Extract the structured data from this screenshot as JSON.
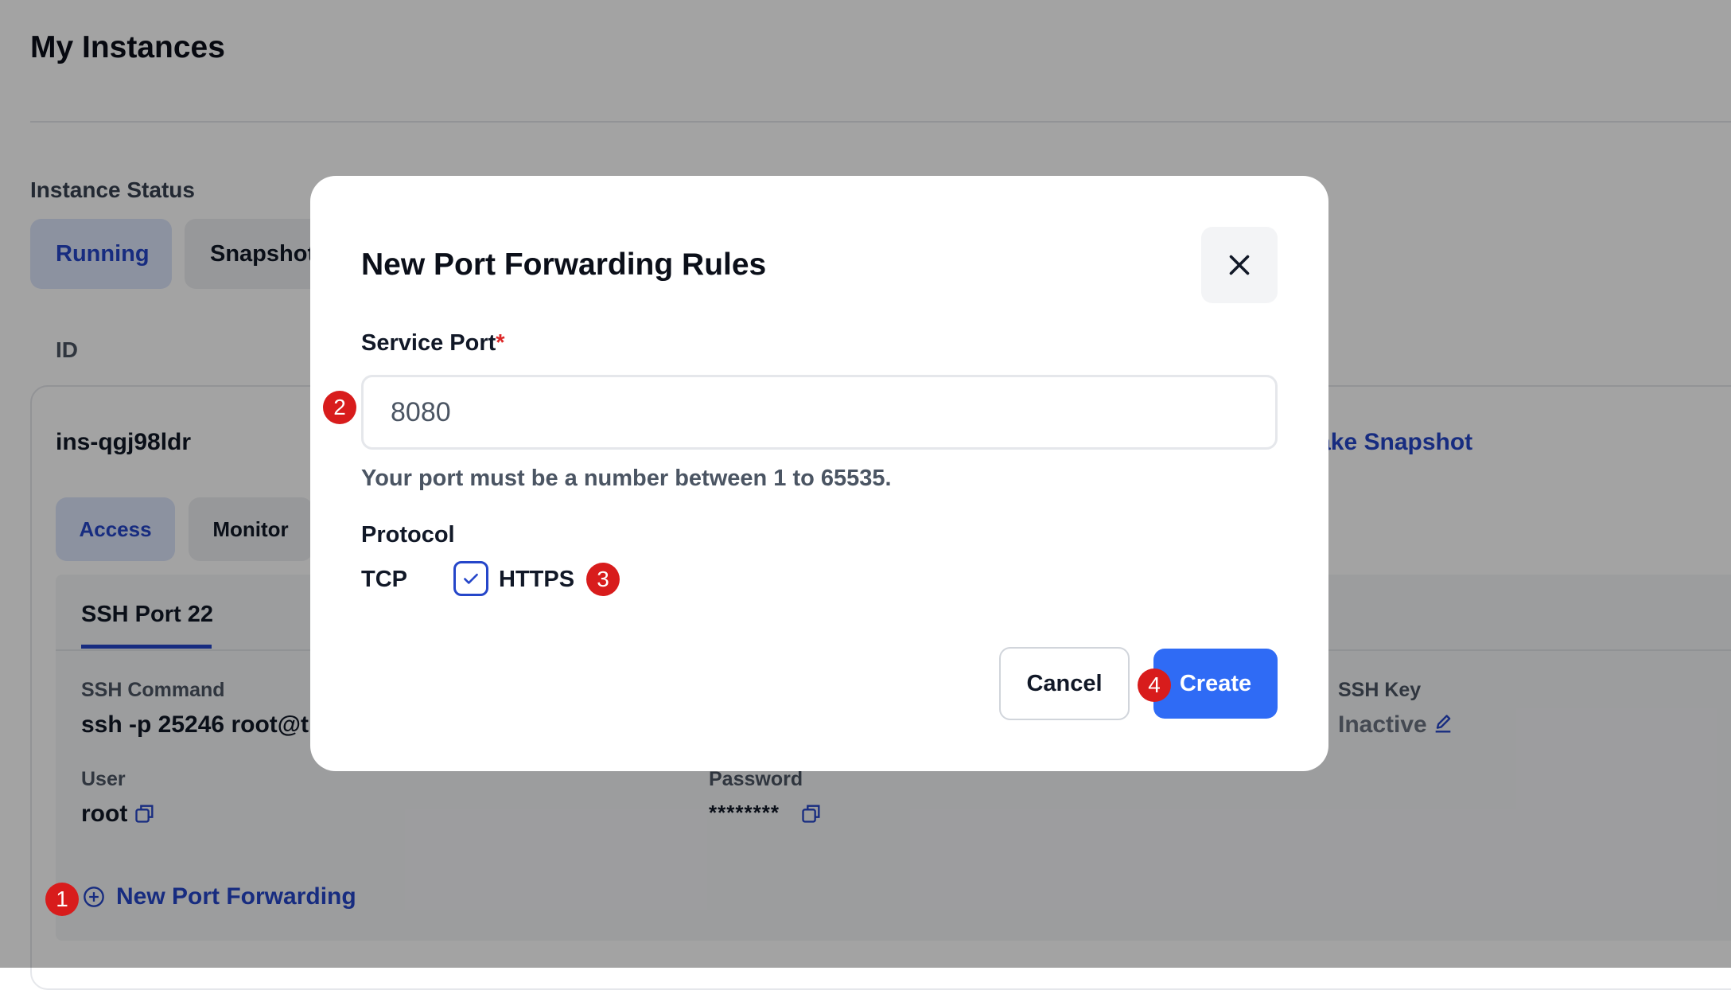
{
  "page": {
    "title": "My Instances",
    "instance_status_label": "Instance Status",
    "status_tabs": [
      "Running",
      "Snapshot"
    ],
    "id_column_label": "ID",
    "instance": {
      "id": "ins-qgj98ldr",
      "take_snapshot_label": "Take Snapshot",
      "sub_tabs": [
        "Access",
        "Monitor"
      ],
      "port_tab": "SSH Port 22",
      "ssh_command_label": "SSH Command",
      "ssh_command_value": "ssh -p 25246 root@t",
      "ssh_key_label": "SSH Key",
      "ssh_key_value": "Inactive",
      "user_label": "User",
      "user_value": "root",
      "password_label": "Password",
      "password_value": "********",
      "new_port_forwarding": "New Port Forwarding"
    }
  },
  "modal": {
    "title": "New Port Forwarding Rules",
    "service_port_label": "Service Port",
    "required_mark": "*",
    "service_port_value": "8080",
    "hint": "Your port must be a number between 1 to 65535.",
    "protocol_label": "Protocol",
    "tcp_label": "TCP",
    "https_label": "HTTPS",
    "https_checked": true,
    "cancel_label": "Cancel",
    "create_label": "Create"
  },
  "badges": [
    "1",
    "2",
    "3",
    "4"
  ],
  "colors": {
    "accent": "#2546c9",
    "primary_button": "#2f6bf5",
    "badge": "#d81c1c",
    "overlay": "rgba(0,0,0,0.36)"
  },
  "icons": [
    "close-icon",
    "check-icon",
    "copy-icon",
    "edit-icon",
    "plus-circle-icon"
  ]
}
